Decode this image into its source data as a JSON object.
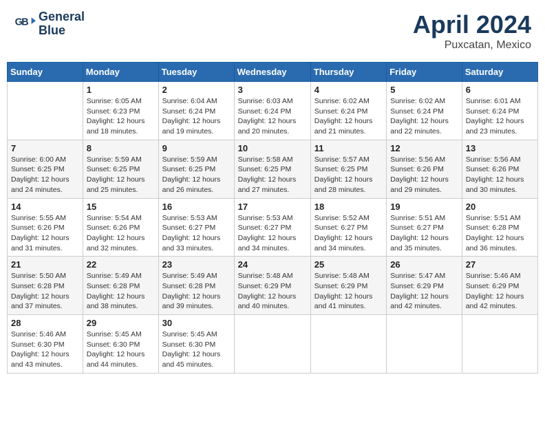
{
  "header": {
    "logo_line1": "General",
    "logo_line2": "Blue",
    "month_title": "April 2024",
    "location": "Puxcatan, Mexico"
  },
  "weekdays": [
    "Sunday",
    "Monday",
    "Tuesday",
    "Wednesday",
    "Thursday",
    "Friday",
    "Saturday"
  ],
  "weeks": [
    [
      {
        "day": "",
        "info": ""
      },
      {
        "day": "1",
        "info": "Sunrise: 6:05 AM\nSunset: 6:23 PM\nDaylight: 12 hours\nand 18 minutes."
      },
      {
        "day": "2",
        "info": "Sunrise: 6:04 AM\nSunset: 6:24 PM\nDaylight: 12 hours\nand 19 minutes."
      },
      {
        "day": "3",
        "info": "Sunrise: 6:03 AM\nSunset: 6:24 PM\nDaylight: 12 hours\nand 20 minutes."
      },
      {
        "day": "4",
        "info": "Sunrise: 6:02 AM\nSunset: 6:24 PM\nDaylight: 12 hours\nand 21 minutes."
      },
      {
        "day": "5",
        "info": "Sunrise: 6:02 AM\nSunset: 6:24 PM\nDaylight: 12 hours\nand 22 minutes."
      },
      {
        "day": "6",
        "info": "Sunrise: 6:01 AM\nSunset: 6:24 PM\nDaylight: 12 hours\nand 23 minutes."
      }
    ],
    [
      {
        "day": "7",
        "info": "Sunrise: 6:00 AM\nSunset: 6:25 PM\nDaylight: 12 hours\nand 24 minutes."
      },
      {
        "day": "8",
        "info": "Sunrise: 5:59 AM\nSunset: 6:25 PM\nDaylight: 12 hours\nand 25 minutes."
      },
      {
        "day": "9",
        "info": "Sunrise: 5:59 AM\nSunset: 6:25 PM\nDaylight: 12 hours\nand 26 minutes."
      },
      {
        "day": "10",
        "info": "Sunrise: 5:58 AM\nSunset: 6:25 PM\nDaylight: 12 hours\nand 27 minutes."
      },
      {
        "day": "11",
        "info": "Sunrise: 5:57 AM\nSunset: 6:25 PM\nDaylight: 12 hours\nand 28 minutes."
      },
      {
        "day": "12",
        "info": "Sunrise: 5:56 AM\nSunset: 6:26 PM\nDaylight: 12 hours\nand 29 minutes."
      },
      {
        "day": "13",
        "info": "Sunrise: 5:56 AM\nSunset: 6:26 PM\nDaylight: 12 hours\nand 30 minutes."
      }
    ],
    [
      {
        "day": "14",
        "info": "Sunrise: 5:55 AM\nSunset: 6:26 PM\nDaylight: 12 hours\nand 31 minutes."
      },
      {
        "day": "15",
        "info": "Sunrise: 5:54 AM\nSunset: 6:26 PM\nDaylight: 12 hours\nand 32 minutes."
      },
      {
        "day": "16",
        "info": "Sunrise: 5:53 AM\nSunset: 6:27 PM\nDaylight: 12 hours\nand 33 minutes."
      },
      {
        "day": "17",
        "info": "Sunrise: 5:53 AM\nSunset: 6:27 PM\nDaylight: 12 hours\nand 34 minutes."
      },
      {
        "day": "18",
        "info": "Sunrise: 5:52 AM\nSunset: 6:27 PM\nDaylight: 12 hours\nand 34 minutes."
      },
      {
        "day": "19",
        "info": "Sunrise: 5:51 AM\nSunset: 6:27 PM\nDaylight: 12 hours\nand 35 minutes."
      },
      {
        "day": "20",
        "info": "Sunrise: 5:51 AM\nSunset: 6:28 PM\nDaylight: 12 hours\nand 36 minutes."
      }
    ],
    [
      {
        "day": "21",
        "info": "Sunrise: 5:50 AM\nSunset: 6:28 PM\nDaylight: 12 hours\nand 37 minutes."
      },
      {
        "day": "22",
        "info": "Sunrise: 5:49 AM\nSunset: 6:28 PM\nDaylight: 12 hours\nand 38 minutes."
      },
      {
        "day": "23",
        "info": "Sunrise: 5:49 AM\nSunset: 6:28 PM\nDaylight: 12 hours\nand 39 minutes."
      },
      {
        "day": "24",
        "info": "Sunrise: 5:48 AM\nSunset: 6:29 PM\nDaylight: 12 hours\nand 40 minutes."
      },
      {
        "day": "25",
        "info": "Sunrise: 5:48 AM\nSunset: 6:29 PM\nDaylight: 12 hours\nand 41 minutes."
      },
      {
        "day": "26",
        "info": "Sunrise: 5:47 AM\nSunset: 6:29 PM\nDaylight: 12 hours\nand 42 minutes."
      },
      {
        "day": "27",
        "info": "Sunrise: 5:46 AM\nSunset: 6:29 PM\nDaylight: 12 hours\nand 42 minutes."
      }
    ],
    [
      {
        "day": "28",
        "info": "Sunrise: 5:46 AM\nSunset: 6:30 PM\nDaylight: 12 hours\nand 43 minutes."
      },
      {
        "day": "29",
        "info": "Sunrise: 5:45 AM\nSunset: 6:30 PM\nDaylight: 12 hours\nand 44 minutes."
      },
      {
        "day": "30",
        "info": "Sunrise: 5:45 AM\nSunset: 6:30 PM\nDaylight: 12 hours\nand 45 minutes."
      },
      {
        "day": "",
        "info": ""
      },
      {
        "day": "",
        "info": ""
      },
      {
        "day": "",
        "info": ""
      },
      {
        "day": "",
        "info": ""
      }
    ]
  ]
}
